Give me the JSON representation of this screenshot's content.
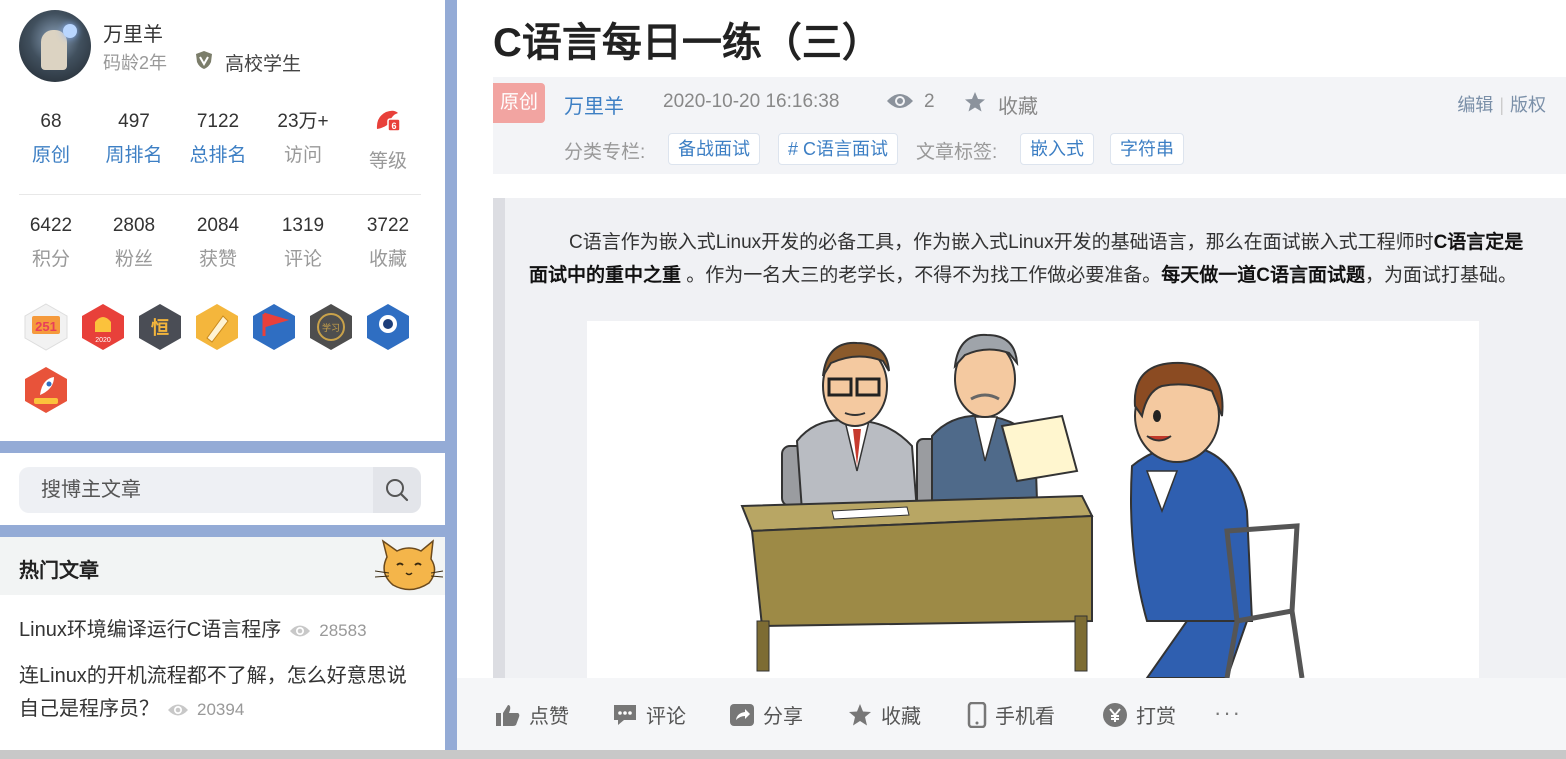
{
  "profile": {
    "name": "万里羊",
    "code_age": "码龄2年",
    "identity": "高校学生",
    "stats_row1": [
      {
        "num": "68",
        "label": "原创"
      },
      {
        "num": "497",
        "label": "周排名"
      },
      {
        "num": "7122",
        "label": "总排名"
      },
      {
        "num": "23万+",
        "label": "访问"
      },
      {
        "num": "",
        "label": "等级"
      }
    ],
    "stats_row2": [
      {
        "num": "6422",
        "label": "积分"
      },
      {
        "num": "2808",
        "label": "粉丝"
      },
      {
        "num": "2084",
        "label": "获赞"
      },
      {
        "num": "1319",
        "label": "评论"
      },
      {
        "num": "3722",
        "label": "收藏"
      }
    ],
    "medals": [
      {
        "icon": "medal-251-icon",
        "text": "251",
        "color": "#f0f0f0"
      },
      {
        "icon": "medal-2020-icon",
        "text": "2020",
        "color": "#e8403a"
      },
      {
        "icon": "medal-persist-icon",
        "text": "恒",
        "color": "#4a4d55"
      },
      {
        "icon": "medal-pen-icon",
        "text": "",
        "color": "#f4b63c"
      },
      {
        "icon": "medal-flag-icon",
        "text": "",
        "color": "#2f6ec2"
      },
      {
        "icon": "medal-study-icon",
        "text": "学习",
        "color": "#555"
      },
      {
        "icon": "medal-astronaut-icon",
        "text": "",
        "color": "#2f6ec2"
      },
      {
        "icon": "medal-rocket-icon",
        "text": "",
        "color": "#e8533a"
      }
    ]
  },
  "search": {
    "placeholder": "搜博主文章"
  },
  "hot": {
    "title": "热门文章",
    "items": [
      {
        "title": "Linux环境编译运行C语言程序",
        "views": "28583"
      },
      {
        "title": "连Linux的开机流程都不了解，怎么好意思说自己是程序员？",
        "views": "20394"
      }
    ]
  },
  "article": {
    "title": "C语言每日一练（三）",
    "original_tag": "原创",
    "author": "万里羊",
    "date": "2020-10-20 16:16:38",
    "view_count": "2",
    "favorite": "收藏",
    "edit": "编辑",
    "copyright": "版权",
    "category_label": "分类专栏:",
    "categories": [
      "备战面试",
      "# C语言面试"
    ],
    "tag_label": "文章标签:",
    "tags": [
      "嵌入式",
      "字符串"
    ],
    "para_1": "C语言作为嵌入式Linux开发的必备工具，作为嵌入式Linux开发的基础语言，那么在面试嵌入式工程师时",
    "para_bold_1": "C语言定是面试中的重中之重",
    "para_2": " 。作为一名大三的老学长，不得不为找工作做必要准备。",
    "para_bold_2": "每天做一道C语言面试题",
    "para_3": "，为面试打基础。"
  },
  "actions": [
    {
      "label": "点赞",
      "icon": "thumbs-up-icon"
    },
    {
      "label": "评论",
      "icon": "comment-icon"
    },
    {
      "label": "分享",
      "icon": "share-icon"
    },
    {
      "label": "收藏",
      "icon": "star-icon"
    },
    {
      "label": "手机看",
      "icon": "phone-icon"
    },
    {
      "label": "打赏",
      "icon": "yen-icon"
    },
    {
      "label": "···",
      "icon": "more-icon"
    }
  ],
  "colors": {
    "accent": "#3d7fc4",
    "original_tag": "#f2a4a1",
    "frame": "#94abd6"
  }
}
